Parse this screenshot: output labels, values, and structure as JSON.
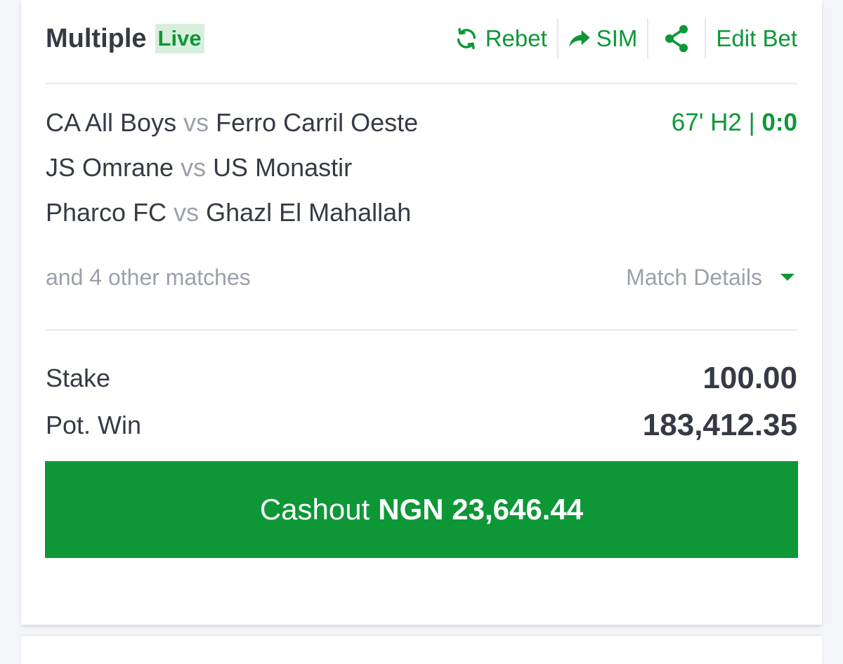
{
  "header": {
    "title": "Multiple",
    "live_badge": "Live",
    "rebet_label": "Rebet",
    "sim_label": "SIM",
    "edit_bet_label": "Edit Bet",
    "icons": [
      "refresh-icon",
      "forward-arrow-icon",
      "share-icon"
    ]
  },
  "matches": [
    {
      "home": "CA All Boys",
      "vs": "vs",
      "away": "Ferro Carril Oeste",
      "time": "67' H2 |",
      "score": "0:0"
    },
    {
      "home": "JS Omrane",
      "vs": "vs",
      "away": "US Monastir"
    },
    {
      "home": "Pharco FC",
      "vs": "vs",
      "away": "Ghazl El Mahallah"
    }
  ],
  "others": {
    "text": "and 4 other matches",
    "details_label": "Match Details"
  },
  "bet": {
    "stake_label": "Stake",
    "stake_value": "100.00",
    "pot_win_label": "Pot. Win",
    "pot_win_value": "183,412.35"
  },
  "cashout": {
    "label": "Cashout",
    "amount": "NGN 23,646.44"
  },
  "colors": {
    "accent": "#0d9737",
    "live_bg": "#d7efdc",
    "text": "#353a45",
    "muted": "#9ca0ad"
  }
}
